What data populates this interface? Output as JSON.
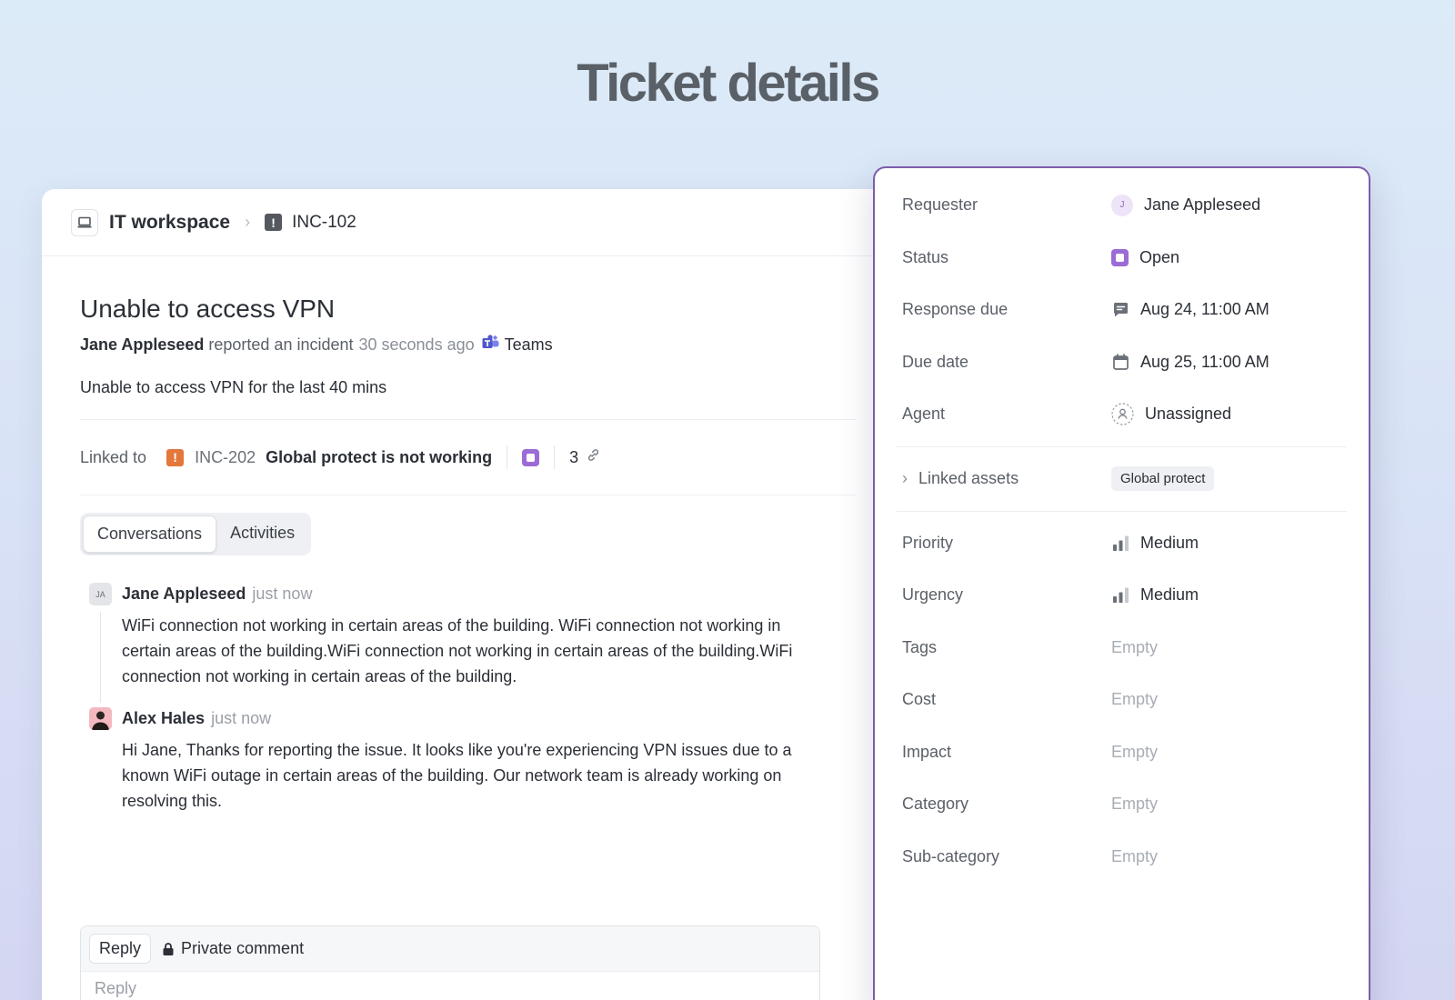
{
  "page_title": "Ticket details",
  "breadcrumb": {
    "workspace": "IT workspace",
    "ticket_id": "INC-102"
  },
  "ticket": {
    "title": "Unable to access VPN",
    "reporter": "Jane Appleseed",
    "action": "reported an incident",
    "time": "30 seconds ago",
    "source": "Teams",
    "description": "Unable to access VPN for the last 40 mins"
  },
  "linked": {
    "label": "Linked to",
    "id": "INC-202",
    "title": "Global protect is not working",
    "count": "3"
  },
  "tabs": [
    {
      "label": "Conversations",
      "active": true
    },
    {
      "label": "Activities",
      "active": false
    }
  ],
  "conversation": [
    {
      "initials": "JA",
      "author": "Jane Appleseed",
      "time": "just now",
      "body": "WiFi connection not working in certain areas of the building. WiFi connection not working in certain areas of the building.WiFi connection not working in certain areas of the building.WiFi connection not working in certain areas of the building."
    },
    {
      "author": "Alex Hales",
      "time": "just now",
      "body": "Hi Jane, Thanks for reporting the issue. It looks like you're experiencing VPN issues due to a known WiFi outage in certain areas of the building. Our network team is already working on resolving this."
    }
  ],
  "reply": {
    "reply_tab": "Reply",
    "private_tab": "Private comment",
    "placeholder": "Reply"
  },
  "properties": {
    "requester": {
      "label": "Requester",
      "initial": "J",
      "value": "Jane Appleseed"
    },
    "status": {
      "label": "Status",
      "value": "Open",
      "color": "#9b6bd6"
    },
    "response_due": {
      "label": "Response due",
      "value": "Aug 24, 11:00 AM",
      "icon": "chat-bubble-icon"
    },
    "due_date": {
      "label": "Due date",
      "value": "Aug 25, 11:00 AM",
      "icon": "calendar-icon"
    },
    "agent": {
      "label": "Agent",
      "value": "Unassigned",
      "icon": "user-icon"
    },
    "linked_assets": {
      "label": "Linked assets",
      "chip": "Global protect"
    },
    "priority": {
      "label": "Priority",
      "value": "Medium",
      "icon": "signal-bars-icon"
    },
    "urgency": {
      "label": "Urgency",
      "value": "Medium",
      "icon": "signal-bars-icon"
    },
    "tags": {
      "label": "Tags",
      "value": "Empty"
    },
    "cost": {
      "label": "Cost",
      "value": "Empty"
    },
    "impact": {
      "label": "Impact",
      "value": "Empty"
    },
    "category": {
      "label": "Category",
      "value": "Empty"
    },
    "subcategory": {
      "label": "Sub-category",
      "value": "Empty"
    }
  },
  "colors": {
    "accent": "#7d5cab",
    "status_open": "#9b6bd6",
    "incident_badge": "#e4773b",
    "teams": "#5059c9"
  }
}
